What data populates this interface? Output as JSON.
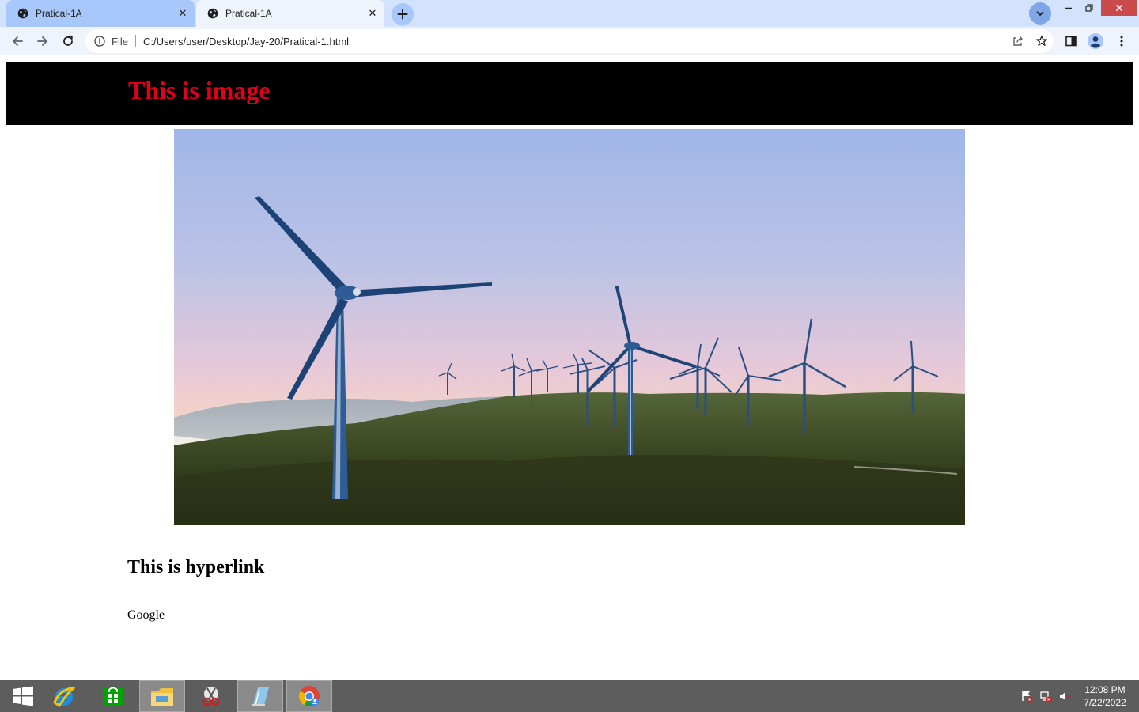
{
  "browser": {
    "tabs": [
      {
        "title": "Pratical-1A",
        "favicon": "globe-icon",
        "active": true
      },
      {
        "title": "Pratical-1A",
        "favicon": "globe-icon",
        "active": false
      }
    ],
    "new_tab_icon": "plus-icon",
    "tab_search_icon": "chevron-down-icon",
    "window_controls": [
      "minimize-icon",
      "restore-icon",
      "close-icon"
    ],
    "nav": {
      "back_icon": "arrow-left-icon",
      "forward_icon": "arrow-right-icon",
      "reload_icon": "reload-icon"
    },
    "address": {
      "security_icon": "info-icon",
      "scheme": "File",
      "url": "C:/Users/user/Desktop/Jay-20/Pratical-1.html",
      "share_icon": "share-icon",
      "bookmark_icon": "star-icon"
    },
    "toolbar_icons": [
      "side-panel-icon",
      "profile-icon",
      "more-vert-icon"
    ],
    "colors": {
      "tabstrip": "#d3e3fd",
      "active_tab": "#a8c7fa",
      "toolbar": "#eef3fc"
    }
  },
  "page": {
    "banner_heading": "This is image",
    "banner_colors": {
      "background": "#000000",
      "text": "#e0001b"
    },
    "image_subject": "wind turbines on a hilly coastline at sunset",
    "hyperlink_heading": "This is hyperlink",
    "link_text": "Google"
  },
  "taskbar": {
    "apps": [
      "windows-start-icon",
      "internet-explorer-icon",
      "store-icon",
      "file-explorer-icon",
      "snipping-tool-icon",
      "notepad-icon",
      "chrome-icon"
    ],
    "tray_icons": [
      "action-center-icon",
      "network-icon",
      "volume-muted-icon"
    ],
    "clock": {
      "time": "12:08 PM",
      "date": "7/22/2022"
    }
  }
}
